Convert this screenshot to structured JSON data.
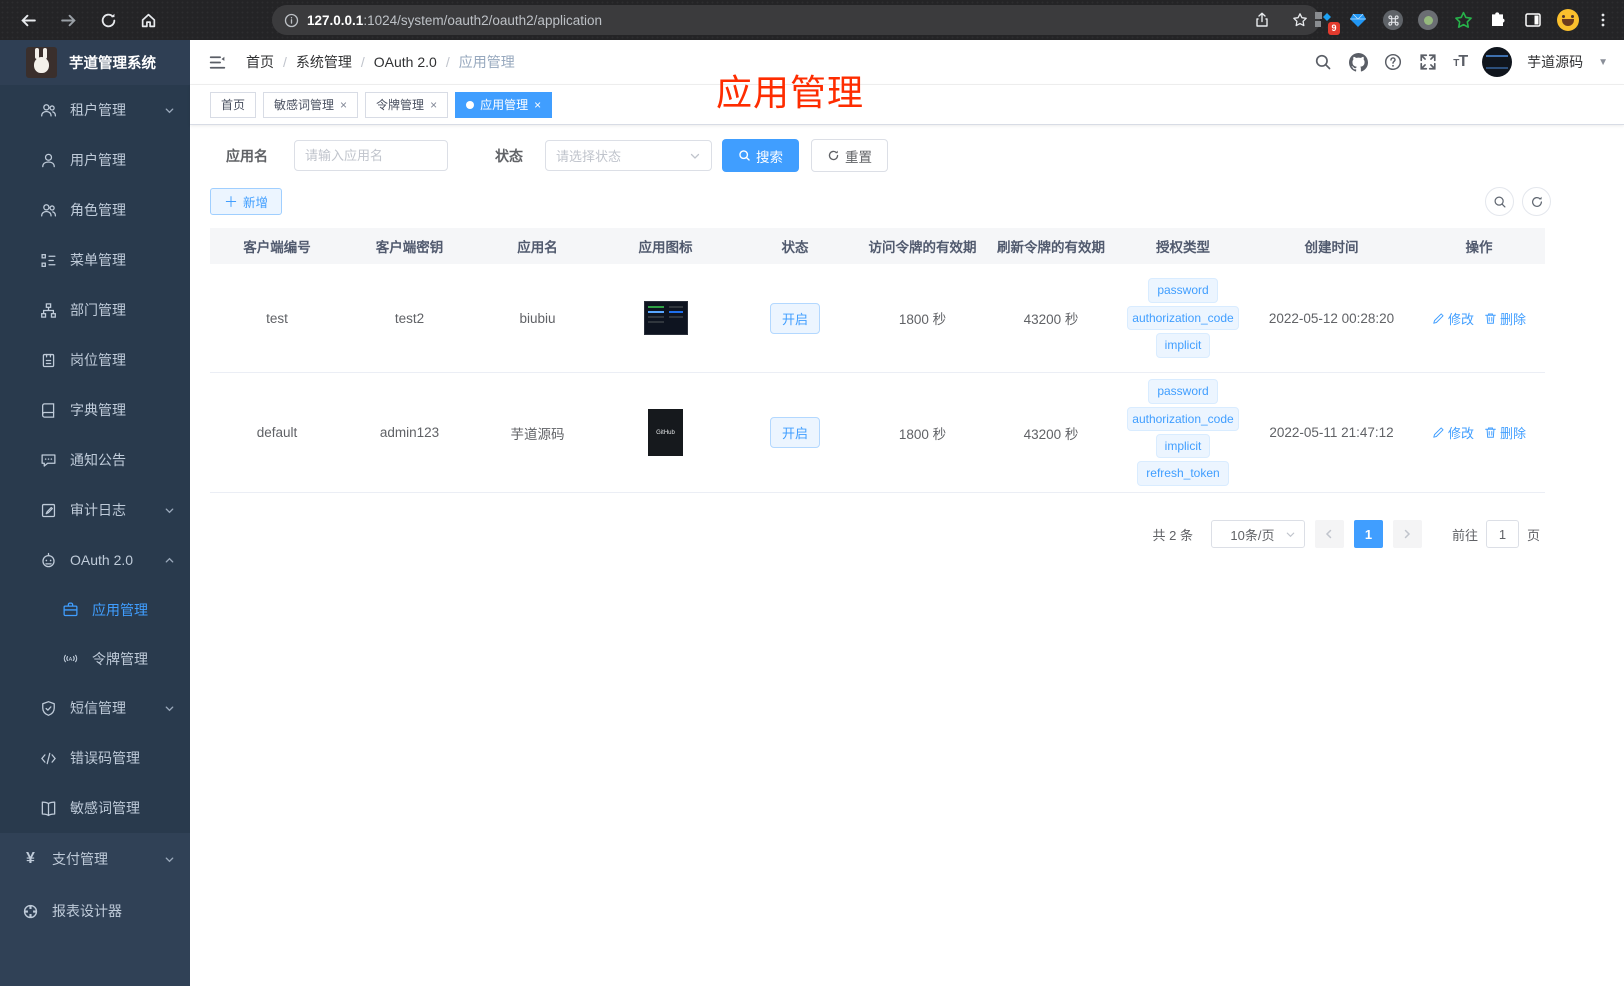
{
  "colors": {
    "accent": "#409eff",
    "sidebar_bg": "#304156",
    "sidebar_submenu_bg": "#293a4d",
    "sidebar_text": "#bfcbd9",
    "tag_bg": "#ecf5ff",
    "tag_text": "#409eff",
    "annotation_red": "#fe2c00",
    "chrome_bg": "#242426",
    "active_tab_bg": "#409eff"
  },
  "browser": {
    "url_host": "127.0.0.1",
    "url_path": ":1024/system/oauth2/oauth2/application",
    "extension_badge": "9"
  },
  "sidebar": {
    "title": "芋道管理系统",
    "items": [
      {
        "label": "租户管理",
        "icon": "tenant-users-icon"
      },
      {
        "label": "用户管理",
        "icon": "user-icon"
      },
      {
        "label": "角色管理",
        "icon": "role-users-icon"
      },
      {
        "label": "菜单管理",
        "icon": "menu-tree-icon"
      },
      {
        "label": "部门管理",
        "icon": "org-chart-icon"
      },
      {
        "label": "岗位管理",
        "icon": "post-badge-icon"
      },
      {
        "label": "字典管理",
        "icon": "dict-book-icon"
      },
      {
        "label": "通知公告",
        "icon": "notice-chat-icon"
      },
      {
        "label": "审计日志",
        "icon": "audit-log-icon"
      },
      {
        "label": "OAuth 2.0",
        "icon": "oauth-robot-icon"
      },
      {
        "label": "应用管理",
        "icon": "app-briefcase-icon"
      },
      {
        "label": "令牌管理",
        "icon": "token-broadcast-icon"
      },
      {
        "label": "短信管理",
        "icon": "sms-shield-icon"
      },
      {
        "label": "错误码管理",
        "icon": "error-code-icon"
      },
      {
        "label": "敏感词管理",
        "icon": "sensitive-book-icon"
      },
      {
        "label": "支付管理",
        "icon": "pay-yen-icon"
      },
      {
        "label": "报表设计器",
        "icon": "report-designer-icon"
      }
    ]
  },
  "header": {
    "breadcrumb": [
      "首页",
      "系统管理",
      "OAuth 2.0",
      "应用管理"
    ],
    "username": "芋道源码"
  },
  "tabs": [
    {
      "label": "首页"
    },
    {
      "label": "敏感词管理"
    },
    {
      "label": "令牌管理"
    },
    {
      "label": "应用管理"
    }
  ],
  "annotation": {
    "text": "应用管理"
  },
  "filters": {
    "name_label": "应用名",
    "name_placeholder": "请输入应用名",
    "status_label": "状态",
    "status_placeholder": "请选择状态",
    "search_label": "搜索",
    "reset_label": "重置",
    "add_label": "新增"
  },
  "table": {
    "columns": [
      "客户端编号",
      "客户端密钥",
      "应用名",
      "应用图标",
      "状态",
      "访问令牌的有效期",
      "刷新令牌的有效期",
      "授权类型",
      "创建时间",
      "操作"
    ],
    "actions": {
      "edit": "修改",
      "delete": "删除"
    },
    "rows": [
      {
        "client_id": "test",
        "secret": "test2",
        "name": "biubiu",
        "status": "开启",
        "access_validity": "1800 秒",
        "refresh_validity": "43200 秒",
        "grant_types": [
          "password",
          "authorization_code",
          "implicit"
        ],
        "created": "2022-05-12 00:28:20"
      },
      {
        "client_id": "default",
        "secret": "admin123",
        "name": "芋道源码",
        "icon_label": "GitHub",
        "status": "开启",
        "access_validity": "1800 秒",
        "refresh_validity": "43200 秒",
        "grant_types": [
          "password",
          "authorization_code",
          "implicit",
          "refresh_token"
        ],
        "created": "2022-05-11 21:47:12"
      }
    ]
  },
  "pagination": {
    "total": "共 2 条",
    "page_size": "10条/页",
    "current_page": "1",
    "goto_label": "前往",
    "goto_value": "1",
    "page_suffix": "页"
  }
}
